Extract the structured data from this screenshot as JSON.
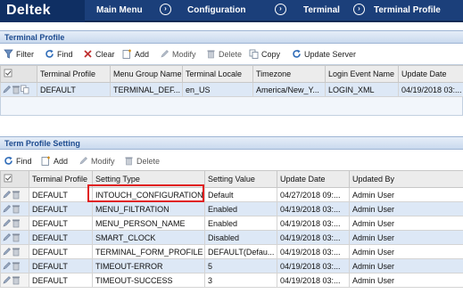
{
  "brand": "Deltek",
  "nav": {
    "main_menu": "Main Menu",
    "configuration": "Configuration",
    "terminal": "Terminal",
    "terminal_profile": "Terminal Profile"
  },
  "terminal_profile_section": {
    "title": "Terminal Profile",
    "toolbar": {
      "filter": "Filter",
      "find": "Find",
      "clear": "Clear",
      "add": "Add",
      "modify": "Modify",
      "delete": "Delete",
      "copy": "Copy",
      "update_server": "Update Server"
    },
    "columns": [
      "Terminal Profile",
      "Menu Group Name",
      "Terminal Locale",
      "Timezone",
      "Login Event Name",
      "Update Date"
    ],
    "rows": [
      [
        "DEFAULT",
        "TERMINAL_DEF...",
        "en_US",
        "America/New_Y...",
        "LOGIN_XML",
        "04/19/2018 03:..."
      ]
    ]
  },
  "term_profile_setting_section": {
    "title": "Term Profile Setting",
    "toolbar": {
      "find": "Find",
      "add": "Add",
      "modify": "Modify",
      "delete": "Delete"
    },
    "columns": [
      "Terminal Profile",
      "Setting Type",
      "Setting Value",
      "Update Date",
      "Updated By"
    ],
    "rows": [
      [
        "DEFAULT",
        "INTOUCH_CONFIGURATION",
        "Default",
        "04/27/2018 09:...",
        "Admin User"
      ],
      [
        "DEFAULT",
        "MENU_FILTRATION",
        "Enabled",
        "04/19/2018 03:...",
        "Admin User"
      ],
      [
        "DEFAULT",
        "MENU_PERSON_NAME",
        "Enabled",
        "04/19/2018 03:...",
        "Admin User"
      ],
      [
        "DEFAULT",
        "SMART_CLOCK",
        "Disabled",
        "04/19/2018 03:...",
        "Admin User"
      ],
      [
        "DEFAULT",
        "TERMINAL_FORM_PROFILE",
        "DEFAULT(Defau...",
        "04/19/2018 03:...",
        "Admin User"
      ],
      [
        "DEFAULT",
        "TIMEOUT-ERROR",
        "5",
        "04/19/2018 03:...",
        "Admin User"
      ],
      [
        "DEFAULT",
        "TIMEOUT-SUCCESS",
        "3",
        "04/19/2018 03:...",
        "Admin User"
      ]
    ],
    "highlighted_row": 0
  },
  "colors": {
    "nav_bar": "#1b3f7a",
    "logo_bg": "#0f2f63",
    "section_header_text": "#1d4b8f",
    "selected_row": "#dde8f6",
    "highlight_box": "#e02020"
  }
}
